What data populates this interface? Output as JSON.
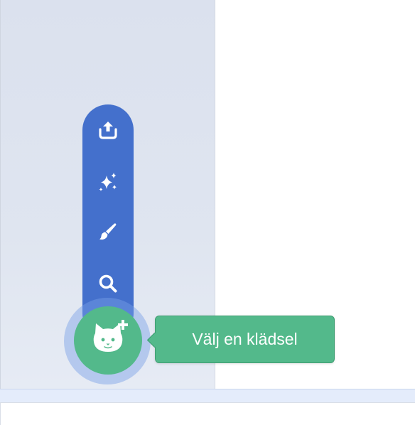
{
  "costume_menu": {
    "items": [
      {
        "icon": "upload-icon"
      },
      {
        "icon": "surprise-sparkle-icon"
      },
      {
        "icon": "paint-brush-icon"
      },
      {
        "icon": "search-icon"
      }
    ],
    "main_button_icon": "cat-plus-icon"
  },
  "tooltip": {
    "label": "Välj en klädsel"
  },
  "colors": {
    "menu_blue": "#4470cc",
    "accent_green": "#53b98b",
    "pane_background": "#dbe1ee"
  }
}
